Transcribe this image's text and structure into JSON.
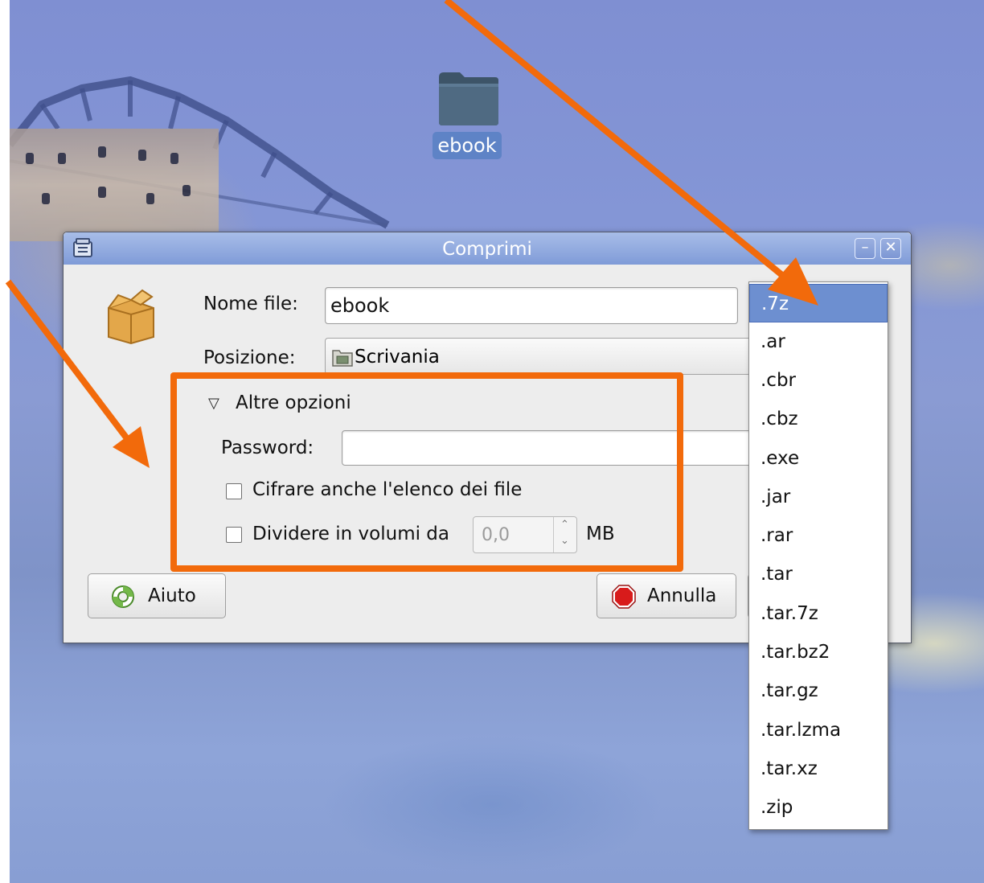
{
  "desktop": {
    "folder_label": "ebook",
    "folder_icon": "folder-icon"
  },
  "dialog": {
    "title": "Comprimi",
    "app_icon": "archive-manager-icon",
    "minimize_icon": "minimize-icon",
    "close_icon": "close-icon",
    "archive_icon": "package-icon",
    "name_label": "Nome file:",
    "name_value": "ebook",
    "location_label": "Posizione:",
    "location_value": "Scrivania",
    "location_icon": "desktop-folder-icon",
    "more_options_label": "Altre opzioni",
    "password_label": "Password:",
    "password_value": "",
    "encrypt_label": "Cifrare anche l'elenco dei file",
    "split_label": "Dividere in volumi da",
    "split_value": "0,0",
    "split_unit": "MB",
    "help_label": "Aiuto",
    "cancel_label": "Annulla"
  },
  "extension_dropdown": {
    "selected": ".7z",
    "options": [
      ".7z",
      ".ar",
      ".cbr",
      ".cbz",
      ".exe",
      ".jar",
      ".rar",
      ".tar",
      ".tar.7z",
      ".tar.bz2",
      ".tar.gz",
      ".tar.lzma",
      ".tar.xz",
      ".zip"
    ]
  },
  "annotations": {
    "color": "#f26a0b"
  },
  "colors": {
    "titlebar": "#8ea7dd",
    "selection": "#6d8fd0",
    "highlight": "#f26a0b"
  }
}
